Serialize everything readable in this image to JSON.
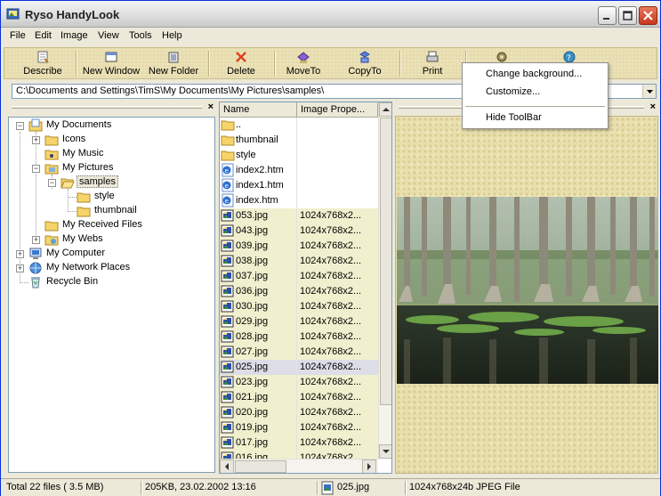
{
  "window": {
    "title": "Ryso HandyLook"
  },
  "menu": [
    "File",
    "Edit",
    "Image",
    "View",
    "Tools",
    "Help"
  ],
  "toolbar": {
    "describe": "Describe",
    "new_window": "New Window",
    "new_folder": "New Folder",
    "delete": "Delete",
    "move_to": "MoveTo",
    "copy_to": "CopyTo",
    "print": "Print"
  },
  "address": {
    "path": "C:\\Documents and Settings\\TimS\\My Documents\\My Pictures\\samples\\"
  },
  "tree": [
    {
      "label": "My Documents"
    },
    {
      "label": "Icons"
    },
    {
      "label": "My Music"
    },
    {
      "label": "My Pictures"
    },
    {
      "label": "samples"
    },
    {
      "label": "style"
    },
    {
      "label": "thumbnail"
    },
    {
      "label": "My Received Files"
    },
    {
      "label": "My Webs"
    },
    {
      "label": "My Computer"
    },
    {
      "label": "My Network Places"
    },
    {
      "label": "Recycle Bin"
    }
  ],
  "list": {
    "columns": [
      "Name",
      "Image Prope..."
    ],
    "rows": [
      {
        "name": "..",
        "info": ""
      },
      {
        "name": "thumbnail",
        "info": ""
      },
      {
        "name": "style",
        "info": ""
      },
      {
        "name": "index2.htm",
        "info": ""
      },
      {
        "name": "index1.htm",
        "info": ""
      },
      {
        "name": "index.htm",
        "info": ""
      },
      {
        "name": "053.jpg",
        "info": "1024x768x2..."
      },
      {
        "name": "043.jpg",
        "info": "1024x768x2..."
      },
      {
        "name": "039.jpg",
        "info": "1024x768x2..."
      },
      {
        "name": "038.jpg",
        "info": "1024x768x2..."
      },
      {
        "name": "037.jpg",
        "info": "1024x768x2..."
      },
      {
        "name": "036.jpg",
        "info": "1024x768x2..."
      },
      {
        "name": "030.jpg",
        "info": "1024x768x2..."
      },
      {
        "name": "029.jpg",
        "info": "1024x768x2..."
      },
      {
        "name": "028.jpg",
        "info": "1024x768x2..."
      },
      {
        "name": "027.jpg",
        "info": "1024x768x2..."
      },
      {
        "name": "025.jpg",
        "info": "1024x768x2..."
      },
      {
        "name": "023.jpg",
        "info": "1024x768x2..."
      },
      {
        "name": "021.jpg",
        "info": "1024x768x2..."
      },
      {
        "name": "020.jpg",
        "info": "1024x768x2..."
      },
      {
        "name": "019.jpg",
        "info": "1024x768x2..."
      },
      {
        "name": "017.jpg",
        "info": "1024x768x2..."
      },
      {
        "name": "016.jpg",
        "info": "1024x768x2..."
      }
    ]
  },
  "context_menu": {
    "change_background": "Change background...",
    "customize": "Customize...",
    "hide_toolbar": "Hide ToolBar"
  },
  "status": {
    "total": "Total 22 files (   3.5 MB)",
    "size_date": "205KB,  23.02.2002 13:16",
    "file": "025.jpg",
    "format": "1024x768x24b JPEG File"
  }
}
